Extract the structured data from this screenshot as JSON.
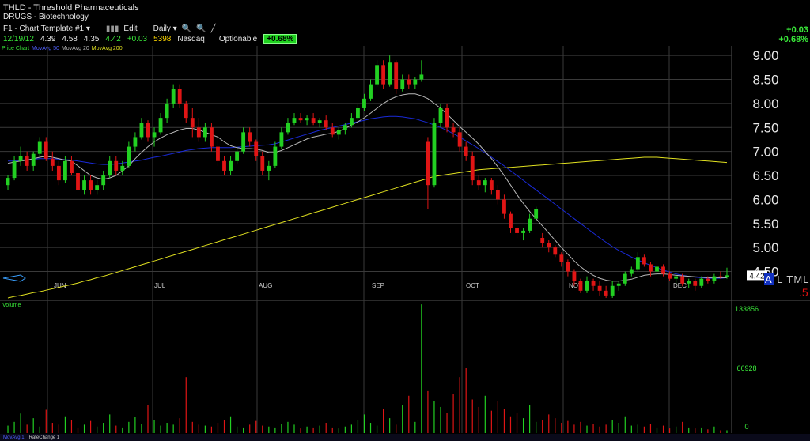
{
  "header": {
    "title": "THLD - Threshold Pharmaceuticals",
    "sector": "DRUGS - Biotechnology",
    "template": "F1 - Chart Template #1",
    "edit_label": "Edit",
    "period": "Daily"
  },
  "quote": {
    "date": "12/19/12",
    "open": "4.39",
    "high": "4.58",
    "low": "4.35",
    "close": "4.42",
    "change": "+0.03",
    "volume": "5398",
    "exchange": "Nasdaq",
    "optionable": "Optionable",
    "pct": "+0.68%"
  },
  "right_change": {
    "abs": "+0.03",
    "pct": "+0.68%"
  },
  "price_panel_labels": [
    "Price Chart",
    "MovAvg 50",
    "MovAvg 20",
    "MovAvg 200"
  ],
  "volume_panel_label": "Volume",
  "bottom_labels": [
    "MovAvg 1",
    "RateChange 1"
  ],
  "atml": {
    "a": "A",
    "rest": "L TML"
  },
  "red_mark": ".5",
  "colors": {
    "up": "#22d022",
    "down": "#e01515",
    "ma20": "#b8b8b8",
    "ma50": "#1a2ad8",
    "ma200": "#e0e020",
    "grid": "#3a3a3a"
  },
  "chart_data": [
    {
      "type": "candlestick",
      "title": "THLD - Threshold Pharmaceuticals",
      "x_labels": [
        "JUN",
        "JUL",
        "AUG",
        "SEP",
        "OCT",
        "NOV",
        "DEC"
      ],
      "y_ticks": [
        4.5,
        5.0,
        5.5,
        6.0,
        6.5,
        7.0,
        7.5,
        8.0,
        8.5,
        9.0
      ],
      "ylim": [
        3.9,
        9.2
      ],
      "last_price": "4.42",
      "candles": [
        [
          6.3,
          6.5,
          6.2,
          6.45
        ],
        [
          6.45,
          6.9,
          6.4,
          6.8
        ],
        [
          6.8,
          7.1,
          6.7,
          6.9
        ],
        [
          6.9,
          7.0,
          6.6,
          6.7
        ],
        [
          6.7,
          7.0,
          6.6,
          6.95
        ],
        [
          6.95,
          7.3,
          6.9,
          7.2
        ],
        [
          7.2,
          7.3,
          6.8,
          6.85
        ],
        [
          6.85,
          7.0,
          6.6,
          6.7
        ],
        [
          6.7,
          6.8,
          6.3,
          6.4
        ],
        [
          6.4,
          6.9,
          6.35,
          6.8
        ],
        [
          6.8,
          6.9,
          6.5,
          6.55
        ],
        [
          6.55,
          6.6,
          6.1,
          6.2
        ],
        [
          6.2,
          6.5,
          6.1,
          6.4
        ],
        [
          6.4,
          6.5,
          6.1,
          6.2
        ],
        [
          6.2,
          6.4,
          6.1,
          6.3
        ],
        [
          6.3,
          6.6,
          6.2,
          6.5
        ],
        [
          6.5,
          6.9,
          6.45,
          6.8
        ],
        [
          6.8,
          6.9,
          6.5,
          6.6
        ],
        [
          6.6,
          6.8,
          6.5,
          6.7
        ],
        [
          6.7,
          7.2,
          6.65,
          7.1
        ],
        [
          7.1,
          7.4,
          7.0,
          7.3
        ],
        [
          7.3,
          7.7,
          7.25,
          7.6
        ],
        [
          7.6,
          7.65,
          7.2,
          7.3
        ],
        [
          7.3,
          7.5,
          7.1,
          7.4
        ],
        [
          7.4,
          7.8,
          7.35,
          7.7
        ],
        [
          7.7,
          8.1,
          7.6,
          8.0
        ],
        [
          8.0,
          8.4,
          7.9,
          8.3
        ],
        [
          8.3,
          8.4,
          7.9,
          8.0
        ],
        [
          8.0,
          8.05,
          7.6,
          7.7
        ],
        [
          7.7,
          7.9,
          7.3,
          7.5
        ],
        [
          7.5,
          7.7,
          7.2,
          7.3
        ],
        [
          7.3,
          7.6,
          7.2,
          7.5
        ],
        [
          7.5,
          7.6,
          7.0,
          7.1
        ],
        [
          7.1,
          7.3,
          6.7,
          6.8
        ],
        [
          6.8,
          6.9,
          6.5,
          6.6
        ],
        [
          6.6,
          6.9,
          6.5,
          6.8
        ],
        [
          6.8,
          7.1,
          6.75,
          7.0
        ],
        [
          7.0,
          7.5,
          6.95,
          7.4
        ],
        [
          7.4,
          7.5,
          7.1,
          7.2
        ],
        [
          7.2,
          7.25,
          6.8,
          6.9
        ],
        [
          6.9,
          7.0,
          6.5,
          6.6
        ],
        [
          6.6,
          6.8,
          6.4,
          6.7
        ],
        [
          6.7,
          7.2,
          6.65,
          7.1
        ],
        [
          7.1,
          7.5,
          7.05,
          7.4
        ],
        [
          7.4,
          7.7,
          7.35,
          7.6
        ],
        [
          7.6,
          7.8,
          7.55,
          7.7
        ],
        [
          7.7,
          7.8,
          7.6,
          7.65
        ],
        [
          7.65,
          7.75,
          7.55,
          7.7
        ],
        [
          7.7,
          7.8,
          7.55,
          7.6
        ],
        [
          7.6,
          7.7,
          7.5,
          7.65
        ],
        [
          7.65,
          7.75,
          7.45,
          7.5
        ],
        [
          7.5,
          7.6,
          7.3,
          7.35
        ],
        [
          7.35,
          7.5,
          7.25,
          7.45
        ],
        [
          7.45,
          7.6,
          7.35,
          7.55
        ],
        [
          7.55,
          7.8,
          7.5,
          7.7
        ],
        [
          7.7,
          8.0,
          7.65,
          7.9
        ],
        [
          7.9,
          8.2,
          7.85,
          8.1
        ],
        [
          8.1,
          8.5,
          8.05,
          8.4
        ],
        [
          8.4,
          8.9,
          8.35,
          8.8
        ],
        [
          8.8,
          8.9,
          8.3,
          8.4
        ],
        [
          8.4,
          9.0,
          8.35,
          8.85
        ],
        [
          8.85,
          8.9,
          8.2,
          8.3
        ],
        [
          8.3,
          8.6,
          8.25,
          8.5
        ],
        [
          8.5,
          8.6,
          8.3,
          8.4
        ],
        [
          8.4,
          8.55,
          8.3,
          8.5
        ],
        [
          8.5,
          8.9,
          8.45,
          8.6
        ],
        [
          7.2,
          7.3,
          5.8,
          6.3
        ],
        [
          6.3,
          7.7,
          6.25,
          7.6
        ],
        [
          7.6,
          8.0,
          7.5,
          7.9
        ],
        [
          7.9,
          8.0,
          7.4,
          7.5
        ],
        [
          7.5,
          7.6,
          7.3,
          7.4
        ],
        [
          7.4,
          7.5,
          7.0,
          7.1
        ],
        [
          7.1,
          7.2,
          6.8,
          6.9
        ],
        [
          6.9,
          7.0,
          6.3,
          6.4
        ],
        [
          6.4,
          6.5,
          6.2,
          6.3
        ],
        [
          6.3,
          6.45,
          6.15,
          6.4
        ],
        [
          6.4,
          6.45,
          6.1,
          6.2
        ],
        [
          6.2,
          6.3,
          5.9,
          6.0
        ],
        [
          6.0,
          6.1,
          5.6,
          5.7
        ],
        [
          5.7,
          5.75,
          5.3,
          5.4
        ],
        [
          5.4,
          5.45,
          5.2,
          5.3
        ],
        [
          5.3,
          5.4,
          5.15,
          5.35
        ],
        [
          5.35,
          5.7,
          5.3,
          5.6
        ],
        [
          5.6,
          5.85,
          5.55,
          5.8
        ],
        [
          5.2,
          5.3,
          5.0,
          5.1
        ],
        [
          5.1,
          5.15,
          4.9,
          5.0
        ],
        [
          5.0,
          5.05,
          4.8,
          4.85
        ],
        [
          4.85,
          4.9,
          4.6,
          4.7
        ],
        [
          4.7,
          4.75,
          4.4,
          4.5
        ],
        [
          4.5,
          4.55,
          4.2,
          4.3
        ],
        [
          4.3,
          4.35,
          4.05,
          4.1
        ],
        [
          4.1,
          4.4,
          4.05,
          4.3
        ],
        [
          4.3,
          4.35,
          4.1,
          4.2
        ],
        [
          4.2,
          4.3,
          4.0,
          4.1
        ],
        [
          4.1,
          4.2,
          3.95,
          4.0
        ],
        [
          4.0,
          4.3,
          3.95,
          4.2
        ],
        [
          4.2,
          4.3,
          4.1,
          4.25
        ],
        [
          4.25,
          4.5,
          4.2,
          4.45
        ],
        [
          4.45,
          4.6,
          4.4,
          4.55
        ],
        [
          4.55,
          4.9,
          4.5,
          4.8
        ],
        [
          4.8,
          4.85,
          4.6,
          4.65
        ],
        [
          4.65,
          4.7,
          4.4,
          4.5
        ],
        [
          4.5,
          4.95,
          4.45,
          4.6
        ],
        [
          4.6,
          4.65,
          4.4,
          4.45
        ],
        [
          4.45,
          4.5,
          4.3,
          4.35
        ],
        [
          4.35,
          4.45,
          4.25,
          4.4
        ],
        [
          4.4,
          4.45,
          4.2,
          4.25
        ],
        [
          4.25,
          4.35,
          4.15,
          4.3
        ],
        [
          4.3,
          4.35,
          4.1,
          4.2
        ],
        [
          4.2,
          4.4,
          4.15,
          4.35
        ],
        [
          4.35,
          4.4,
          4.25,
          4.3
        ],
        [
          4.3,
          4.45,
          4.25,
          4.4
        ],
        [
          4.4,
          4.5,
          4.35,
          4.38
        ],
        [
          4.39,
          4.58,
          4.35,
          4.42
        ]
      ],
      "ma20": [
        6.75,
        6.78,
        6.8,
        6.82,
        6.85,
        6.88,
        6.9,
        6.88,
        6.85,
        6.82,
        6.8,
        6.7,
        6.6,
        6.5,
        6.45,
        6.42,
        6.45,
        6.5,
        6.6,
        6.7,
        6.85,
        6.98,
        7.1,
        7.2,
        7.28,
        7.35,
        7.4,
        7.45,
        7.48,
        7.48,
        7.45,
        7.4,
        7.35,
        7.3,
        7.2,
        7.12,
        7.08,
        7.06,
        7.06,
        7.05,
        7.02,
        6.98,
        6.98,
        7.02,
        7.08,
        7.14,
        7.2,
        7.26,
        7.3,
        7.33,
        7.36,
        7.38,
        7.42,
        7.48,
        7.55,
        7.62,
        7.7,
        7.8,
        7.9,
        8.0,
        8.08,
        8.14,
        8.18,
        8.2,
        8.2,
        8.16,
        8.1,
        8.0,
        7.9,
        7.78,
        7.65,
        7.52,
        7.4,
        7.28,
        7.15,
        7.0,
        6.85,
        6.68,
        6.5,
        6.3,
        6.1,
        5.92,
        5.75,
        5.6,
        5.45,
        5.3,
        5.15,
        5.0,
        4.86,
        4.72,
        4.6,
        4.5,
        4.42,
        4.36,
        4.32,
        4.3,
        4.3,
        4.32,
        4.34,
        4.38,
        4.42,
        4.44,
        4.45,
        4.45,
        4.44,
        4.42,
        4.41,
        4.4,
        4.39,
        4.38,
        4.37,
        4.37,
        4.37,
        4.37
      ],
      "ma50": [
        6.8,
        6.8,
        6.82,
        6.83,
        6.84,
        6.85,
        6.85,
        6.85,
        6.84,
        6.83,
        6.82,
        6.8,
        6.78,
        6.76,
        6.74,
        6.73,
        6.73,
        6.74,
        6.76,
        6.78,
        6.8,
        6.82,
        6.85,
        6.88,
        6.9,
        6.93,
        6.96,
        6.99,
        7.02,
        7.04,
        7.06,
        7.07,
        7.08,
        7.08,
        7.08,
        7.08,
        7.09,
        7.1,
        7.11,
        7.12,
        7.13,
        7.14,
        7.16,
        7.2,
        7.24,
        7.28,
        7.32,
        7.36,
        7.4,
        7.44,
        7.47,
        7.5,
        7.53,
        7.56,
        7.59,
        7.62,
        7.65,
        7.68,
        7.7,
        7.72,
        7.73,
        7.73,
        7.72,
        7.7,
        7.68,
        7.64,
        7.6,
        7.55,
        7.5,
        7.44,
        7.37,
        7.3,
        7.22,
        7.14,
        7.06,
        6.97,
        6.88,
        6.79,
        6.7,
        6.6,
        6.5,
        6.4,
        6.3,
        6.2,
        6.1,
        6.0,
        5.9,
        5.8,
        5.7,
        5.6,
        5.5,
        5.4,
        5.3,
        5.2,
        5.11,
        5.02,
        4.94,
        4.87,
        4.8,
        4.74,
        4.68,
        4.63,
        4.58,
        4.53,
        4.49,
        4.45,
        4.42,
        4.4,
        4.38,
        4.37,
        4.36,
        4.36,
        4.36,
        4.37
      ],
      "ma200": [
        3.95,
        3.98,
        4.0,
        4.03,
        4.06,
        4.08,
        4.11,
        4.14,
        4.17,
        4.2,
        4.23,
        4.26,
        4.3,
        4.33,
        4.37,
        4.4,
        4.44,
        4.48,
        4.52,
        4.56,
        4.6,
        4.64,
        4.68,
        4.72,
        4.76,
        4.8,
        4.84,
        4.88,
        4.92,
        4.96,
        5.0,
        5.04,
        5.08,
        5.12,
        5.16,
        5.2,
        5.24,
        5.28,
        5.32,
        5.36,
        5.4,
        5.44,
        5.48,
        5.52,
        5.56,
        5.6,
        5.64,
        5.68,
        5.72,
        5.76,
        5.8,
        5.84,
        5.88,
        5.92,
        5.96,
        6.0,
        6.04,
        6.08,
        6.12,
        6.16,
        6.2,
        6.24,
        6.28,
        6.32,
        6.36,
        6.4,
        6.44,
        6.48,
        6.5,
        6.52,
        6.54,
        6.56,
        6.58,
        6.6,
        6.62,
        6.63,
        6.64,
        6.65,
        6.66,
        6.67,
        6.68,
        6.69,
        6.7,
        6.71,
        6.72,
        6.73,
        6.74,
        6.75,
        6.76,
        6.77,
        6.78,
        6.79,
        6.8,
        6.81,
        6.82,
        6.83,
        6.84,
        6.85,
        6.86,
        6.87,
        6.88,
        6.88,
        6.88,
        6.87,
        6.86,
        6.85,
        6.84,
        6.83,
        6.82,
        6.81,
        6.8,
        6.79,
        6.78,
        6.77
      ]
    },
    {
      "type": "bar",
      "title": "Volume",
      "y_ticks": [
        0,
        66928,
        133856
      ],
      "ylim": [
        0,
        133856
      ],
      "values": [
        8000,
        12000,
        21000,
        9000,
        16000,
        7000,
        25000,
        11000,
        9000,
        18000,
        14000,
        6000,
        9000,
        13000,
        7000,
        11000,
        20000,
        8000,
        6000,
        12000,
        17000,
        10000,
        30000,
        14000,
        8000,
        11000,
        9000,
        16000,
        60000,
        12000,
        9000,
        8000,
        7000,
        11000,
        14000,
        18000,
        7000,
        6000,
        9000,
        13000,
        8000,
        7000,
        6000,
        10000,
        12000,
        9000,
        5000,
        7000,
        6000,
        8000,
        11000,
        6000,
        5000,
        7000,
        9000,
        14000,
        20000,
        11000,
        8000,
        26000,
        16000,
        9000,
        30000,
        40000,
        12000,
        138000,
        45000,
        34000,
        28000,
        22000,
        42000,
        60000,
        70000,
        36000,
        28000,
        40000,
        24000,
        34000,
        26000,
        18000,
        22000,
        16000,
        30000,
        12000,
        14000,
        20000,
        16000,
        11000,
        13000,
        9000,
        12000,
        8000,
        10000,
        7000,
        9000,
        14000,
        11000,
        18000,
        8000,
        9000,
        7000,
        10000,
        6000,
        8000,
        5000,
        7000,
        12000,
        6000,
        5000,
        6000,
        4000,
        7000,
        3000,
        3000
      ]
    }
  ]
}
